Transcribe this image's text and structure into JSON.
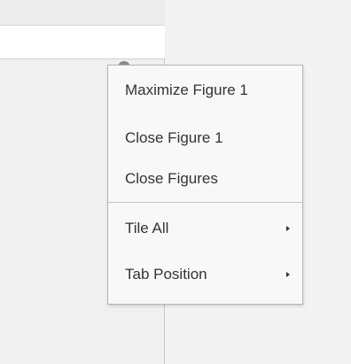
{
  "menu": {
    "items": [
      {
        "label": "Maximize Figure 1"
      },
      {
        "label": "Close Figure 1"
      },
      {
        "label": "Close Figures"
      },
      {
        "label": "Tile All",
        "submenu": true
      },
      {
        "label": "Tab Position",
        "submenu": true
      }
    ]
  },
  "icons": {
    "dropdown_trigger": "chevron-down-circle-icon",
    "submenu_arrow": "caret-right-icon"
  }
}
